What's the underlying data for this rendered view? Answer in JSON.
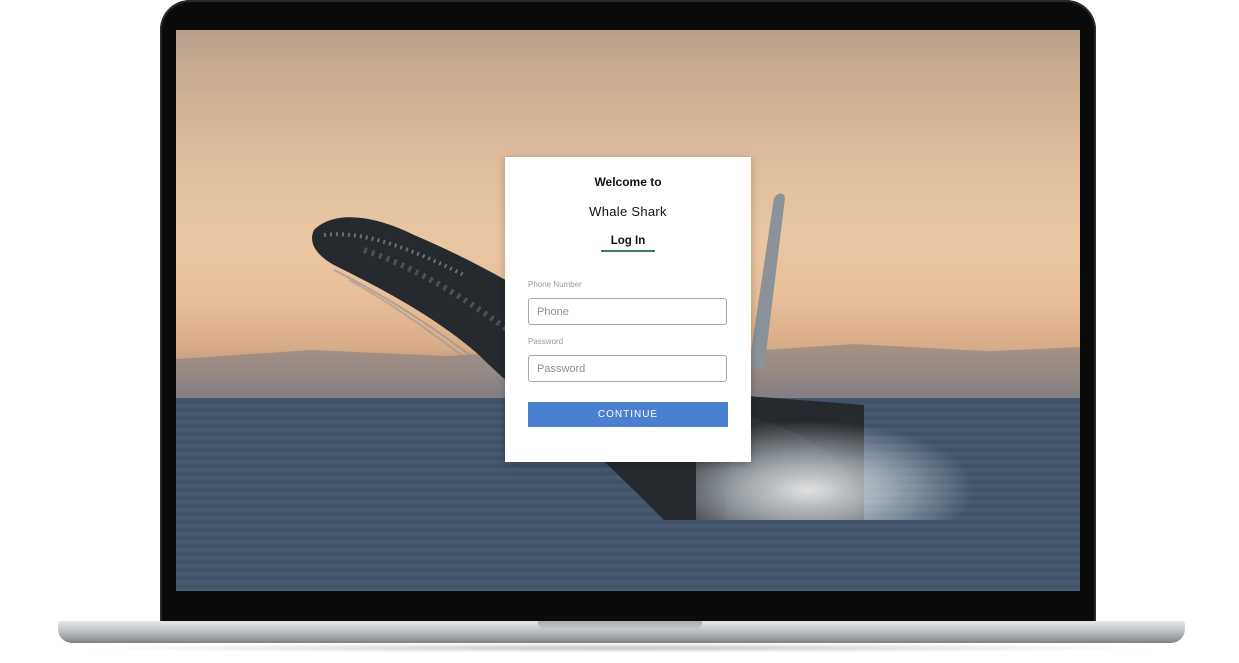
{
  "login": {
    "welcome_text": "Welcome to",
    "brand_name": "Whale Shark",
    "tab_label": "Log In",
    "phone_label": "Phone Number",
    "phone_placeholder": "Phone",
    "password_label": "Password",
    "password_placeholder": "Password",
    "continue_label": "CONTINUE"
  },
  "colors": {
    "accent_underline": "#3f7a56",
    "button": "#4b7fcf"
  }
}
